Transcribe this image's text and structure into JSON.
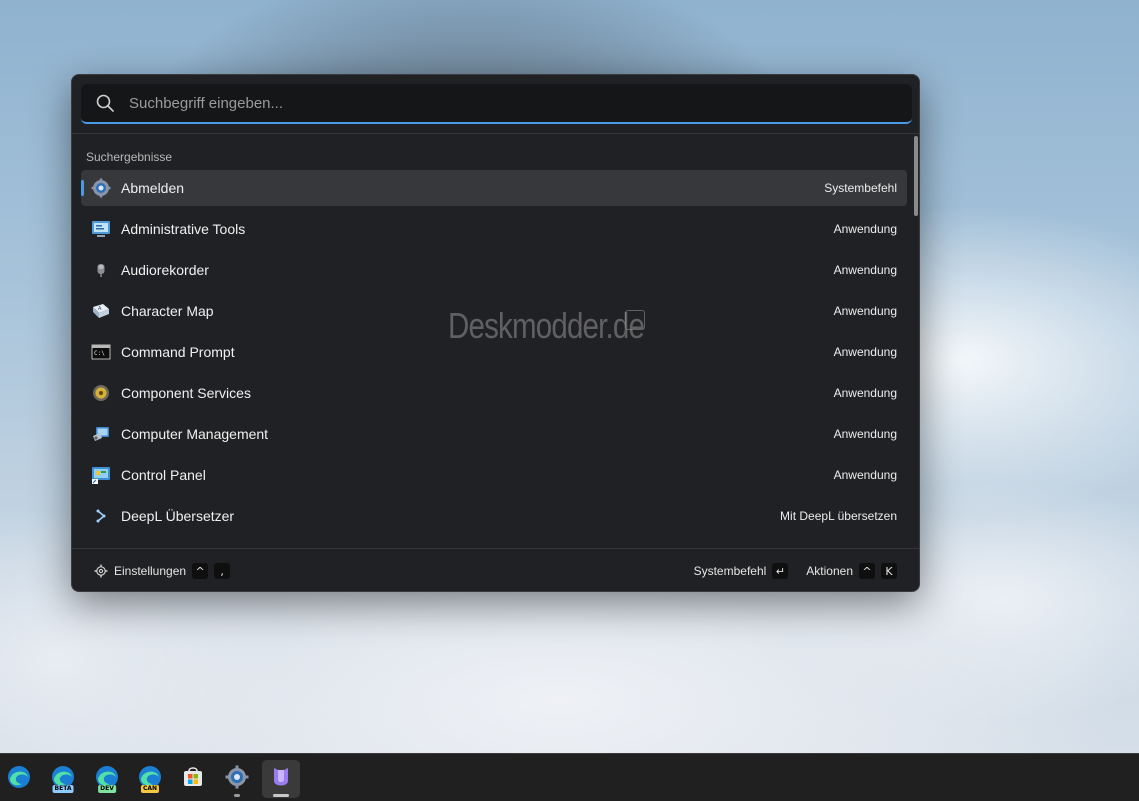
{
  "search": {
    "placeholder": "Suchbegriff eingeben..."
  },
  "section_title": "Suchergebnisse",
  "results": [
    {
      "label": "Abmelden",
      "kind": "Systembefehl",
      "icon": "gear-icon",
      "selected": true
    },
    {
      "label": "Administrative Tools",
      "kind": "Anwendung",
      "icon": "admin-tools-icon"
    },
    {
      "label": "Audiorekorder",
      "kind": "Anwendung",
      "icon": "microphone-icon"
    },
    {
      "label": "Character Map",
      "kind": "Anwendung",
      "icon": "character-map-icon"
    },
    {
      "label": "Command Prompt",
      "kind": "Anwendung",
      "icon": "terminal-icon"
    },
    {
      "label": "Component Services",
      "kind": "Anwendung",
      "icon": "component-services-icon"
    },
    {
      "label": "Computer Management",
      "kind": "Anwendung",
      "icon": "computer-management-icon"
    },
    {
      "label": "Control Panel",
      "kind": "Anwendung",
      "icon": "control-panel-icon"
    },
    {
      "label": "DeepL Übersetzer",
      "kind": "Mit DeepL übersetzen",
      "icon": "deepl-icon"
    }
  ],
  "footer": {
    "settings_label": "Einstellungen",
    "settings_keys": [
      "^",
      ","
    ],
    "primary_label": "Systembefehl",
    "primary_key": "↵",
    "actions_label": "Aktionen",
    "actions_keys": [
      "^",
      "K"
    ]
  },
  "watermark": "Deskmodder.de",
  "taskbar": {
    "apps": [
      {
        "name": "edge-icon",
        "badge": ""
      },
      {
        "name": "edge-beta-icon",
        "badge": "BETA"
      },
      {
        "name": "edge-dev-icon",
        "badge": "DEV"
      },
      {
        "name": "edge-canary-icon",
        "badge": "CAN"
      },
      {
        "name": "store-icon",
        "badge": ""
      },
      {
        "name": "settings-icon",
        "badge": ""
      },
      {
        "name": "powertoys-run-icon",
        "badge": ""
      }
    ]
  },
  "colors": {
    "accent": "#4c9be8",
    "panel": "#202124",
    "selected_row": "#37383c",
    "taskbar": "#202020"
  }
}
